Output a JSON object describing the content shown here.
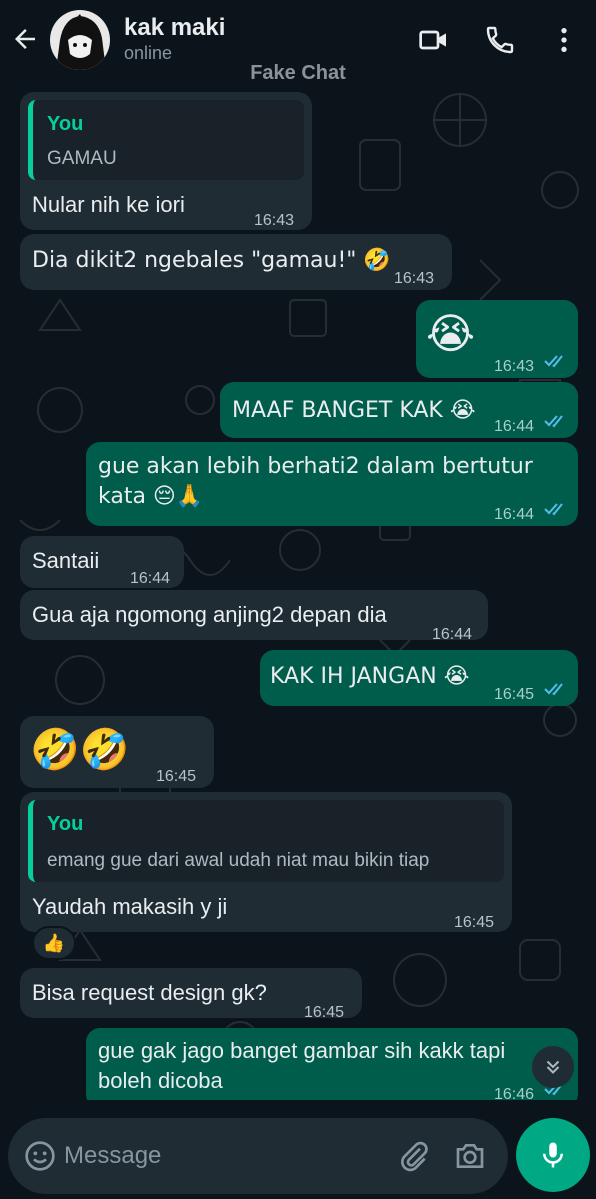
{
  "header": {
    "contact_name": "kak maki",
    "status": "online",
    "watermark": "Fake Chat"
  },
  "messages": [
    {
      "dir": "in",
      "quote_author": "You",
      "quote_text": "GAMAU",
      "text": "Nular nih ke iori",
      "time": "16:43"
    },
    {
      "dir": "in",
      "text": "Dia dikit2 ngebales \"gamau!\" 🤣",
      "time": "16:43"
    },
    {
      "dir": "out",
      "text": "😭",
      "time": "16:43",
      "ticks": "read"
    },
    {
      "dir": "out",
      "text": "MAAF BANGET KAK 😭",
      "time": "16:44",
      "ticks": "read"
    },
    {
      "dir": "out",
      "text": "gue akan lebih berhati2 dalam bertutur kata 😔🙏",
      "time": "16:44",
      "ticks": "read"
    },
    {
      "dir": "in",
      "text": "Santaii",
      "time": "16:44"
    },
    {
      "dir": "in",
      "text": "Gua aja ngomong anjing2 depan dia",
      "time": "16:44"
    },
    {
      "dir": "out",
      "text": "KAK IH JANGAN 😭",
      "time": "16:45",
      "ticks": "read"
    },
    {
      "dir": "in",
      "text": "🤣🤣",
      "time": "16:45"
    },
    {
      "dir": "in",
      "quote_author": "You",
      "quote_text": "emang gue dari awal udah niat mau bikin tiap",
      "text": "Yaudah makasih y ji",
      "time": "16:45",
      "reaction": "👍"
    },
    {
      "dir": "in",
      "text": "Bisa request design gk?",
      "time": "16:45"
    },
    {
      "dir": "out",
      "text": "gue gak jago banget gambar sih kakk tapi boleh dicoba",
      "time": "16:46",
      "ticks": "read"
    }
  ],
  "input": {
    "placeholder": "Message"
  },
  "colors": {
    "background": "#0b141a",
    "incoming_bubble": "#1f2c34",
    "outgoing_bubble": "#005c4b",
    "accent": "#00a884",
    "read_ticks": "#53bdeb"
  },
  "icons": [
    "back-arrow-icon",
    "video-call-icon",
    "phone-icon",
    "more-options-icon",
    "emoji-icon",
    "attach-icon",
    "camera-icon",
    "mic-icon",
    "scroll-down-icon"
  ]
}
